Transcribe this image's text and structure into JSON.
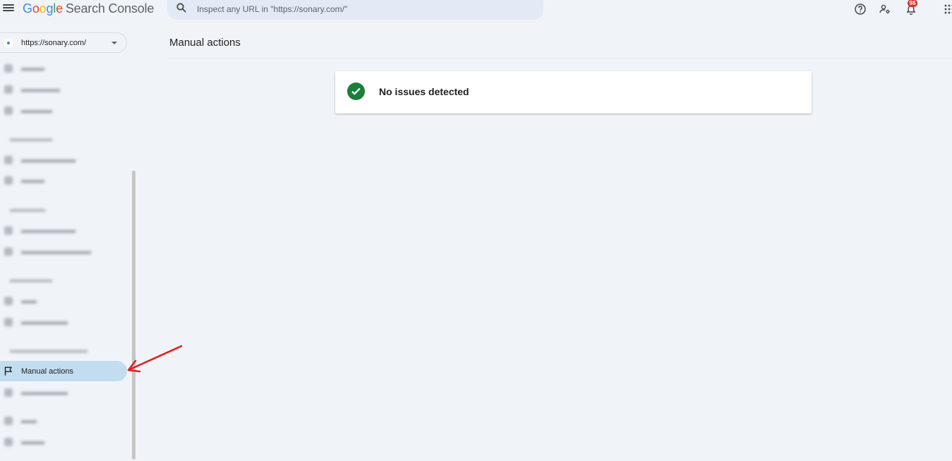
{
  "header": {
    "logo_google": [
      "G",
      "o",
      "o",
      "g",
      "l",
      "e"
    ],
    "logo_product": "Search Console",
    "search_placeholder": "Inspect any URL in \"https://sonary.com/\"",
    "notification_count": "98"
  },
  "sidebar": {
    "property": "https://sonary.com/",
    "active_item": "Manual actions"
  },
  "main": {
    "page_title": "Manual actions",
    "status_message": "No issues detected"
  },
  "colors": {
    "accent": "#c2dcf0",
    "success": "#188038",
    "annotation_arrow": "#e02020",
    "badge": "#d93025"
  }
}
